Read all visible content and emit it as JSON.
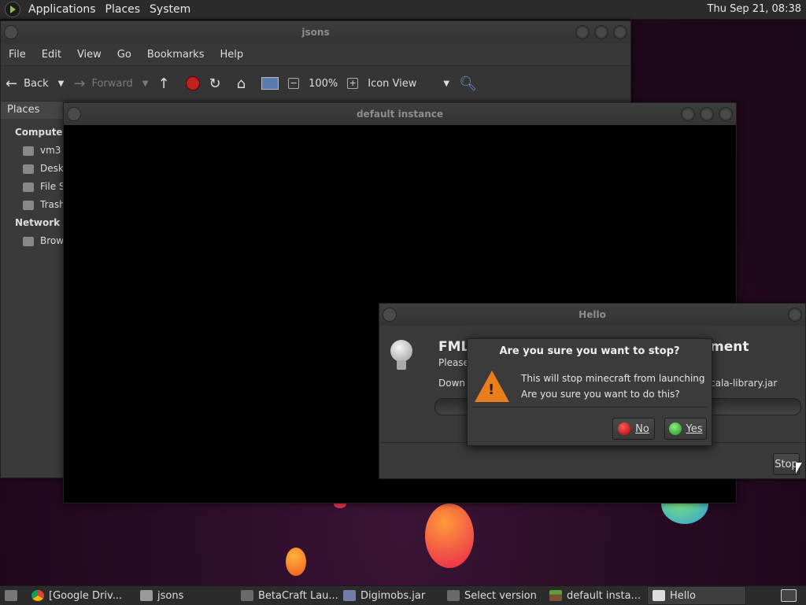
{
  "top_panel": {
    "menus": [
      "Applications",
      "Places",
      "System"
    ],
    "clock": "Thu Sep 21, 08:38"
  },
  "file_manager": {
    "title": "jsons",
    "menu": [
      "File",
      "Edit",
      "View",
      "Go",
      "Bookmarks",
      "Help"
    ],
    "toolbar": {
      "back": "Back",
      "forward": "Forward",
      "zoom": "100%",
      "view_mode": "Icon View"
    },
    "sidebar": {
      "header": "Places",
      "sections": [
        {
          "label": "Computer",
          "items": [
            "vm3",
            "Desk",
            "File S",
            "Trash"
          ]
        },
        {
          "label": "Network",
          "items": [
            "Brow"
          ]
        }
      ]
    }
  },
  "instance_window": {
    "title": "default instance"
  },
  "hello_dialog": {
    "title": "Hello",
    "heading_left": "FML",
    "heading_right": "ment",
    "line1": "Please",
    "download_left": "Down",
    "download_right": "cala-library.jar",
    "stop_button": "Stop"
  },
  "confirm_dialog": {
    "title": "Are you sure you want to stop?",
    "message_line1": "This will stop minecraft from launching",
    "message_line2": "Are you sure you want to do this?",
    "no_button": "No",
    "yes_button": "Yes"
  },
  "taskbar": {
    "items": [
      "[Google Driv...",
      "jsons",
      "BetaCraft Lau...",
      "Digimobs.jar",
      "Select version",
      "default insta...",
      "Hello"
    ]
  },
  "colors": {
    "accent_orange": "#e87f1a",
    "no_red": "#d11a1a",
    "yes_green": "#3fb43f"
  }
}
